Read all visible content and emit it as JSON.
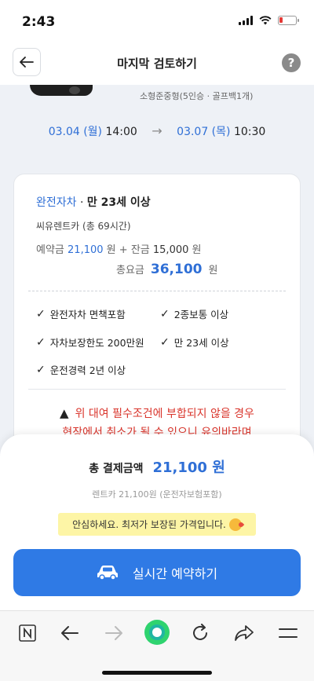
{
  "status": {
    "time": "2:43"
  },
  "header": {
    "title": "마지막 검토하기",
    "help_label": "?"
  },
  "car": {
    "spec": "소형준중형(5인승 · 골프백1개)"
  },
  "schedule": {
    "start_date": "03.04 (월)",
    "start_time": "14:00",
    "end_date": "03.07 (목)",
    "end_time": "10:30",
    "arrow": "→"
  },
  "card": {
    "insurance_name": "완전자차",
    "insurance_sep": " · ",
    "age_requirement": "만 23세 이상",
    "company": "씨유렌트카 (총 69시간)",
    "deposit_label": "예약금",
    "deposit_amount": "21,100",
    "won": "원",
    "plus": "+",
    "balance_label": "잔금",
    "balance_amount": "15,000",
    "total_label": "총요금",
    "total_amount": "36,100",
    "conditions": [
      "완전자차 면책포함",
      "2종보통 이상",
      "자차보장한도 200만원",
      "만 23세 이상",
      "운전경력 2년 이상"
    ],
    "warning_line1": "위 대여 필수조건에 부합되지 않을 경우",
    "warning_line2": "현장에서 취소가 될 수 있으니 유의바라며"
  },
  "sheet": {
    "pay_label": "총 결제금액",
    "pay_value": "21,100 원",
    "pay_detail": "렌트카 21,100원 (운전자보험포함)",
    "badge_text": "안심하세요. 최저가 보장된 가격입니다.",
    "reserve_label": "실시간 예약하기"
  },
  "colors": {
    "accent": "#2f7ae5",
    "link_blue": "#2f6fd6",
    "warning": "#d9342b",
    "badge_bg": "#fdf5a6"
  },
  "icons": [
    "back-arrow-icon",
    "help-icon",
    "check-icon",
    "warning-icon",
    "car-icon",
    "naver-n-icon",
    "browser-back-icon",
    "browser-forward-icon",
    "home-circle-icon",
    "reload-icon",
    "share-icon",
    "menu-icon"
  ]
}
